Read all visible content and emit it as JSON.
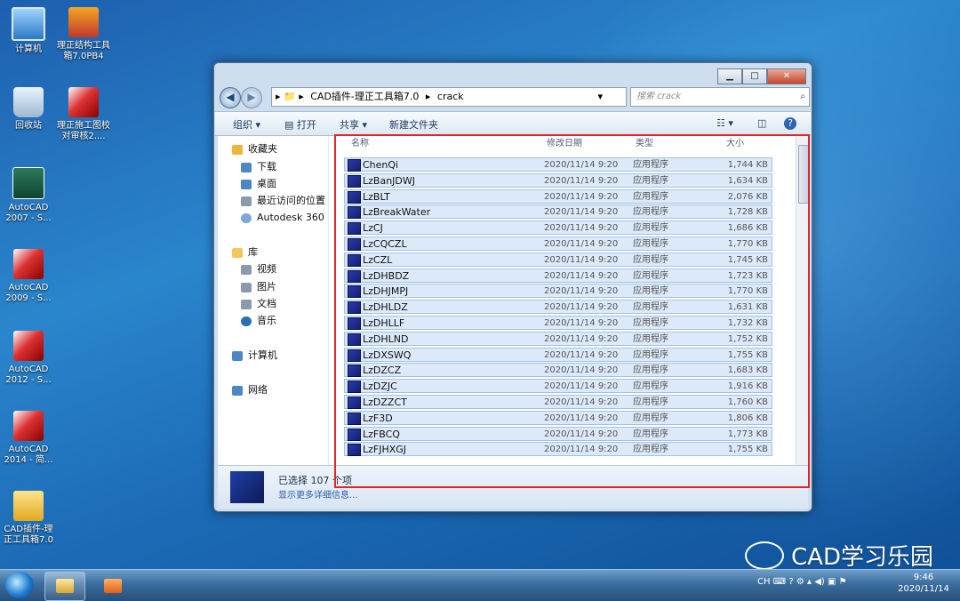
{
  "desktop": {
    "icons": [
      {
        "label": "计算机",
        "icon": "computer-icon"
      },
      {
        "label": "理正结构工具箱7.0PB4",
        "icon": "toolbox-icon"
      },
      {
        "label": "回收站",
        "icon": "recycle-bin-icon"
      },
      {
        "label": "理正施工图校对审核2....",
        "icon": "review-app-icon"
      },
      {
        "label": "AutoCAD 2007 - S...",
        "icon": "autocad-icon"
      },
      {
        "label": "AutoCAD 2009 - S...",
        "icon": "autocad-icon"
      },
      {
        "label": "AutoCAD 2012 - S...",
        "icon": "autocad-icon"
      },
      {
        "label": "AutoCAD 2014 - 简...",
        "icon": "autocad-icon"
      },
      {
        "label": "CAD插件-理正工具箱7.0",
        "icon": "folder-icon"
      }
    ]
  },
  "window": {
    "breadcrumb": [
      "CAD插件-理正工具箱7.0",
      "crack"
    ],
    "search_placeholder": "搜索 crack",
    "toolbar": {
      "organize": "组织 ▾",
      "open": "打开",
      "share": "共享 ▾",
      "new_folder": "新建文件夹"
    },
    "nav": {
      "favorites": "收藏夹",
      "downloads": "下载",
      "desktop": "桌面",
      "recent": "最近访问的位置",
      "autodesk": "Autodesk 360",
      "libraries": "库",
      "videos": "视频",
      "pictures": "图片",
      "documents": "文档",
      "music": "音乐",
      "computer": "计算机",
      "network": "网络"
    },
    "columns": {
      "name": "名称",
      "date": "修改日期",
      "type": "类型",
      "size": "大小"
    },
    "files": [
      {
        "name": "ChenQi",
        "date": "2020/11/14 9:20",
        "type": "应用程序",
        "size": "1,744 KB"
      },
      {
        "name": "LzBanJDWJ",
        "date": "2020/11/14 9:20",
        "type": "应用程序",
        "size": "1,634 KB"
      },
      {
        "name": "LzBLT",
        "date": "2020/11/14 9:20",
        "type": "应用程序",
        "size": "2,076 KB"
      },
      {
        "name": "LzBreakWater",
        "date": "2020/11/14 9:20",
        "type": "应用程序",
        "size": "1,728 KB"
      },
      {
        "name": "LzCJ",
        "date": "2020/11/14 9:20",
        "type": "应用程序",
        "size": "1,686 KB"
      },
      {
        "name": "LzCQCZL",
        "date": "2020/11/14 9:20",
        "type": "应用程序",
        "size": "1,770 KB"
      },
      {
        "name": "LzCZL",
        "date": "2020/11/14 9:20",
        "type": "应用程序",
        "size": "1,745 KB"
      },
      {
        "name": "LzDHBDZ",
        "date": "2020/11/14 9:20",
        "type": "应用程序",
        "size": "1,723 KB"
      },
      {
        "name": "LzDHJMPJ",
        "date": "2020/11/14 9:20",
        "type": "应用程序",
        "size": "1,770 KB"
      },
      {
        "name": "LzDHLDZ",
        "date": "2020/11/14 9:20",
        "type": "应用程序",
        "size": "1,631 KB"
      },
      {
        "name": "LzDHLLF",
        "date": "2020/11/14 9:20",
        "type": "应用程序",
        "size": "1,732 KB"
      },
      {
        "name": "LzDHLND",
        "date": "2020/11/14 9:20",
        "type": "应用程序",
        "size": "1,752 KB"
      },
      {
        "name": "LzDXSWQ",
        "date": "2020/11/14 9:20",
        "type": "应用程序",
        "size": "1,755 KB"
      },
      {
        "name": "LzDZCZ",
        "date": "2020/11/14 9:20",
        "type": "应用程序",
        "size": "1,683 KB"
      },
      {
        "name": "LzDZJC",
        "date": "2020/11/14 9:20",
        "type": "应用程序",
        "size": "1,916 KB"
      },
      {
        "name": "LzDZZCT",
        "date": "2020/11/14 9:20",
        "type": "应用程序",
        "size": "1,760 KB"
      },
      {
        "name": "LzF3D",
        "date": "2020/11/14 9:20",
        "type": "应用程序",
        "size": "1,806 KB"
      },
      {
        "name": "LzFBCQ",
        "date": "2020/11/14 9:20",
        "type": "应用程序",
        "size": "1,773 KB"
      },
      {
        "name": "LzFJHXGJ",
        "date": "2020/11/14 9:20",
        "type": "应用程序",
        "size": "1,755 KB"
      }
    ],
    "details": {
      "selected": "已选择 107 个项",
      "more": "显示更多详细信息..."
    }
  },
  "taskbar": {
    "ime": "CH",
    "time": "9:46",
    "date": "2020/11/14"
  },
  "watermark": "CAD学习乐园"
}
